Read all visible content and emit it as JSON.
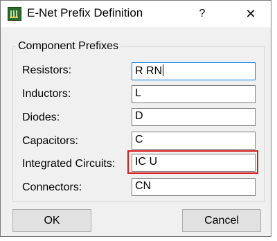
{
  "window": {
    "title": "E-Net Prefix Definition",
    "help_label": "?",
    "close_label": "✕"
  },
  "group": {
    "label": "Component Prefixes"
  },
  "fields": [
    {
      "label": "Resistors:",
      "value": "R RN"
    },
    {
      "label": "Inductors:",
      "value": "L"
    },
    {
      "label": "Diodes:",
      "value": "D"
    },
    {
      "label": "Capacitors:",
      "value": "C"
    },
    {
      "label": "Integrated Circuits:",
      "value": "IC U"
    },
    {
      "label": "Connectors:",
      "value": "CN"
    }
  ],
  "buttons": {
    "ok_label": "OK",
    "cancel_label": "Cancel"
  },
  "colors": {
    "highlight": "#d9191c",
    "focus_border": "#0078d7",
    "app_icon": "#2e6b2a"
  },
  "icons": {
    "app": "enet-app-icon",
    "close": "close-icon",
    "help": "help-icon"
  }
}
